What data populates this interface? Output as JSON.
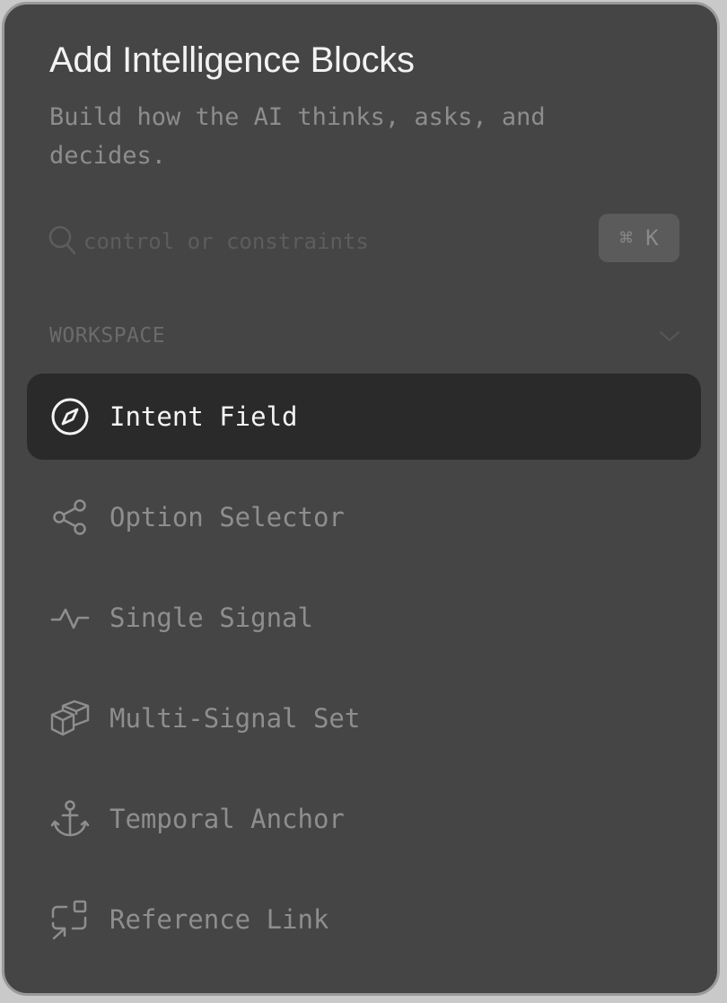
{
  "header": {
    "title": "Add Intelligence Blocks",
    "subtitle": "Build how the AI thinks, asks, and decides."
  },
  "search": {
    "placeholder": "control or constraints",
    "value": "",
    "shortcut": "⌘ K",
    "icon": "search-icon"
  },
  "section": {
    "label": "WORKSPACE",
    "icon": "chevron-down-icon"
  },
  "items": [
    {
      "label": "Intent Field",
      "icon": "compass-icon",
      "active": true
    },
    {
      "label": "Option Selector",
      "icon": "share-nodes-icon",
      "active": false
    },
    {
      "label": "Single Signal",
      "icon": "pulse-icon",
      "active": false
    },
    {
      "label": "Multi-Signal Set",
      "icon": "boxes-icon",
      "active": false
    },
    {
      "label": "Temporal Anchor",
      "icon": "anchor-icon",
      "active": false
    },
    {
      "label": "Reference Link",
      "icon": "link-arrow-icon",
      "active": false
    }
  ],
  "colors": {
    "panel_bg": "#454545",
    "active_bg": "#2a2a2a",
    "active_text": "#f4f4f4",
    "inactive_text": "#8e8e8e",
    "border": "#9a9a9a"
  }
}
